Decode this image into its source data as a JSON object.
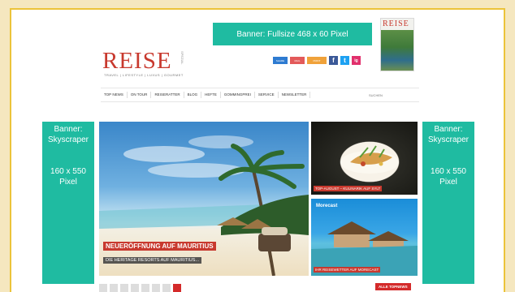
{
  "banner_top": {
    "label": "Banner: Fullsize 468 x 60 Pixel"
  },
  "magazine": {
    "title": "REISE"
  },
  "logo": {
    "text": "REISE",
    "tagline": "TRAVEL | LIFESTYLE | LUXUS | GOURMET",
    "side": "SPEZIAL"
  },
  "share": {
    "buttons": [
      "SHARE",
      "MAIL",
      "PRINT"
    ],
    "icons": [
      "f",
      "t",
      "ig"
    ]
  },
  "nav": {
    "items": [
      "TOP NEWS",
      "ON TOUR",
      "REISERATTER",
      "BLOG",
      "HEFTE",
      "GOMMINGPREI",
      "SERVICE",
      "NEWSLETTER"
    ],
    "search_placeholder": "SUCHEN"
  },
  "skyscraper_left": {
    "line1": "Banner: Skyscraper",
    "line2": "160 x 550 Pixel"
  },
  "skyscraper_right": {
    "line1": "Banner: Skyscraper",
    "line2": "160 x 550 Pixel"
  },
  "hero": {
    "title": "NEUERÖFFNUNG AUF MAURITIUS",
    "subtitle": "DIE HERITAGE RESORTS AUF MAURITIUS..."
  },
  "tiles": [
    {
      "caption": "TOP-AUGUST – KULINARIK AUF SYLT"
    },
    {
      "brand": "Morecast",
      "caption": "IHR REISEWETTER AUF MORECAST"
    }
  ],
  "pager": {
    "active_index": 7
  },
  "all_topnews": "ALLE TOPNEWS",
  "colors": {
    "accent_teal": "#1fbba1",
    "brand_red": "#c8392e",
    "frame": "#ecc33a",
    "background": "#f5e7bf"
  }
}
